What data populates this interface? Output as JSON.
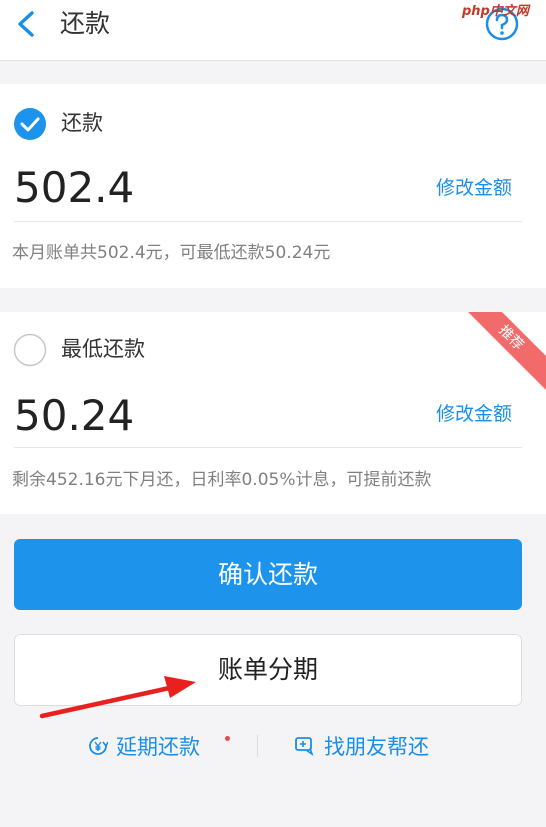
{
  "header": {
    "title": "还款",
    "watermark": "php中文网"
  },
  "full_payment": {
    "label": "还款",
    "amount": "502.4",
    "edit_label": "修改金额",
    "note": "本月账单共502.4元，可最低还款50.24元",
    "selected": true
  },
  "minimum_payment": {
    "label": "最低还款",
    "amount": "50.24",
    "edit_label": "修改金额",
    "note": "剩余452.16元下月还，日利率0.05%计息，可提前还款",
    "badge": "推荐",
    "selected": false
  },
  "buttons": {
    "confirm": "确认还款",
    "installment": "账单分期"
  },
  "links": {
    "extend": "延期还款",
    "friend_help": "找朋友帮还"
  },
  "colors": {
    "accent": "#1d93ec",
    "badge": "#f26b6b",
    "annotation_arrow": "#e8211f"
  },
  "annotation": {
    "icon": "red-arrow-icon"
  }
}
